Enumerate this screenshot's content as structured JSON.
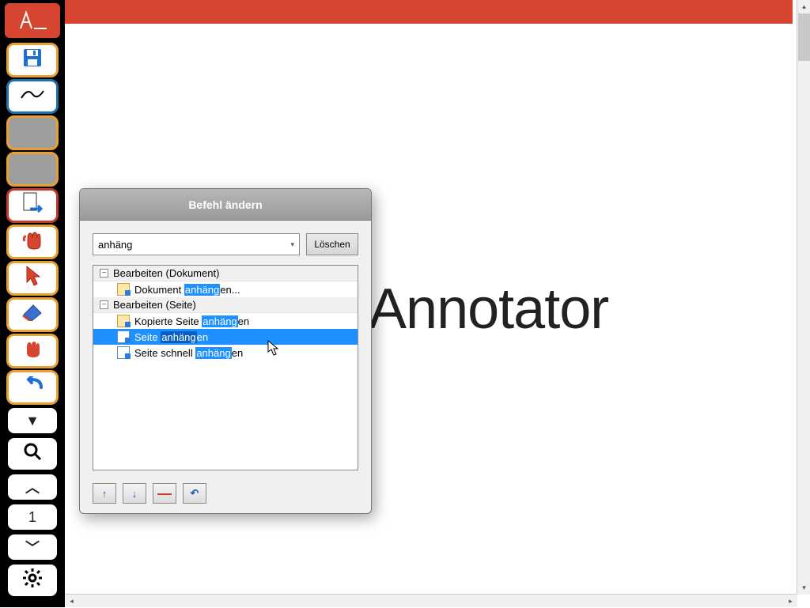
{
  "app_logo_label": "\\\\",
  "sidebar": {
    "buttons": [
      {
        "name": "app-logo",
        "style": "logo"
      },
      {
        "name": "save-button",
        "style": "orange",
        "icon": "save-icon"
      },
      {
        "name": "pen-tool",
        "style": "teal",
        "icon": "pen-icon"
      },
      {
        "name": "blank-1",
        "style": "orange"
      },
      {
        "name": "blank-2",
        "style": "orange"
      },
      {
        "name": "insert-page",
        "style": "red",
        "icon": "page-right-icon"
      },
      {
        "name": "pan-hand",
        "style": "orange",
        "icon": "hand-red-icon"
      },
      {
        "name": "select-arrow",
        "style": "orange",
        "icon": "arrow-red-icon"
      },
      {
        "name": "eraser",
        "style": "orange",
        "icon": "eraser-icon"
      },
      {
        "name": "grab-hand",
        "style": "orange",
        "icon": "hand-solid-icon"
      },
      {
        "name": "undo",
        "style": "orange",
        "icon": "undo-blue-icon"
      },
      {
        "name": "collapse-down",
        "style": "white",
        "icon": "caret-down-icon"
      },
      {
        "name": "zoom",
        "style": "white",
        "icon": "magnifier-icon"
      },
      {
        "name": "prev-page",
        "style": "white",
        "icon": "chevron-up-icon"
      },
      {
        "name": "page-number",
        "style": "white",
        "text": "1"
      },
      {
        "name": "next-page",
        "style": "white",
        "icon": "chevron-down-icon"
      },
      {
        "name": "settings",
        "style": "white",
        "icon": "gear-icon"
      }
    ]
  },
  "canvas": {
    "background_heading": "Annotator"
  },
  "page_indicator": "1",
  "dialog": {
    "title": "Befehl ändern",
    "search_value": "anhäng",
    "clear_label": "Löschen",
    "groups": [
      {
        "label": "Bearbeiten (Dokument)",
        "items": [
          {
            "pre": "Dokument ",
            "hl": "anhäng",
            "post": "en...",
            "icon": "paste",
            "selected": false
          }
        ]
      },
      {
        "label": "Bearbeiten (Seite)",
        "items": [
          {
            "pre": "Kopierte Seite ",
            "hl": "anhäng",
            "post": "en",
            "icon": "paste",
            "selected": false
          },
          {
            "pre": "Seite ",
            "hl": "anhäng",
            "post": "en",
            "icon": "page",
            "selected": true
          },
          {
            "pre": "Seite schnell ",
            "hl": "anhäng",
            "post": "en",
            "icon": "page",
            "selected": false
          }
        ]
      }
    ],
    "footer": {
      "up": "↑",
      "down": "↓",
      "remove": "—",
      "reset": "↶"
    }
  }
}
